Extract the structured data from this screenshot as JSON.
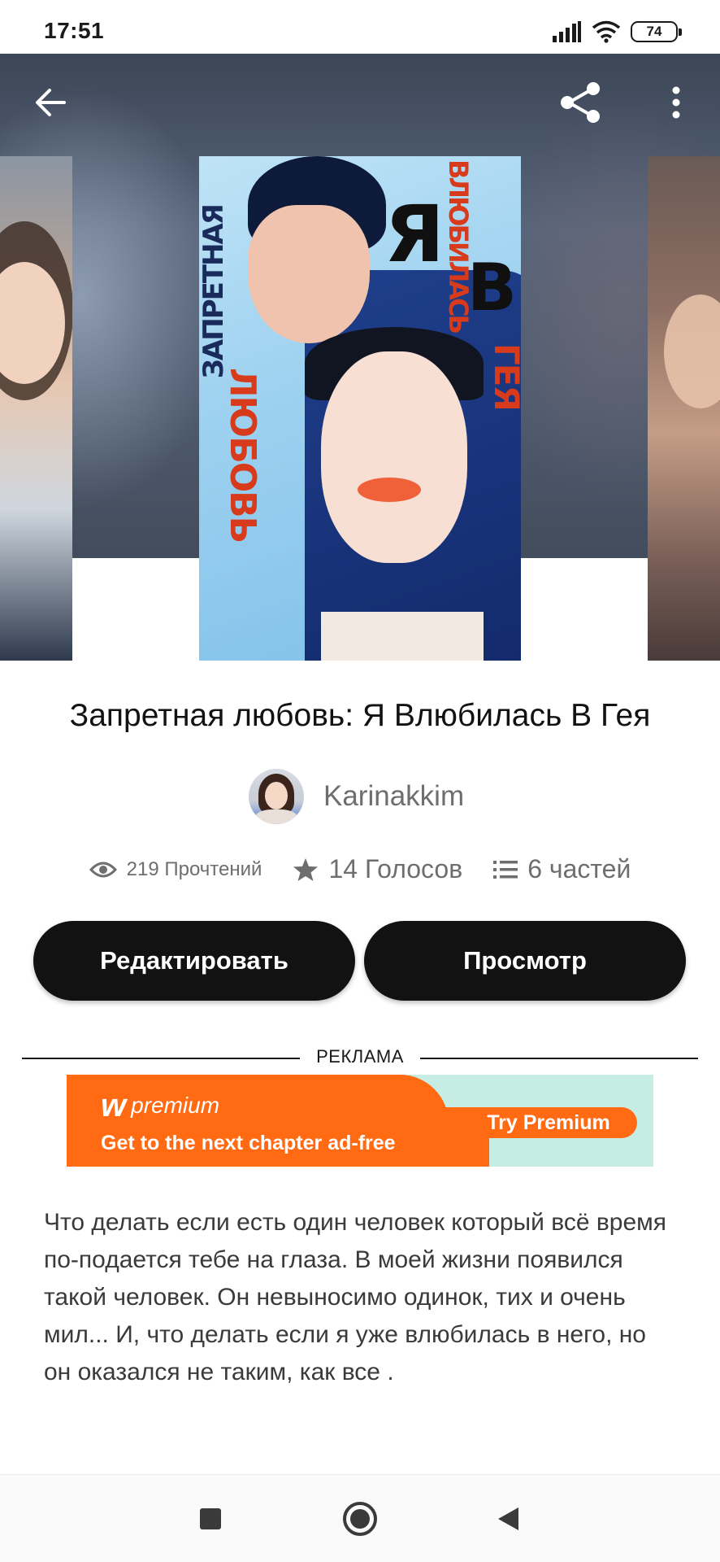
{
  "status_bar": {
    "time": "17:51",
    "battery": "74"
  },
  "cover_text": {
    "title_vertical_1": "ЗАПРЕТНАЯ",
    "title_vertical_2": "ЛЮБОВЬ",
    "letter_ya": "Я",
    "letter_v": "В",
    "word_vlyubilas": "ВЛЮБИЛАСЬ",
    "word_geya": "ГЕЯ"
  },
  "story": {
    "title": "Запретная любовь: Я Влюбилась В Гея",
    "author": "Karinakkim",
    "reads": "219 Прочтений",
    "votes": "14 Голосов",
    "parts": "6 частей",
    "description": "Что делать если есть один человек который всё время по-подается тебе на глаза. В моей жизни появился такой человек. Он невыносимо одинок, тих и очень мил... И, что делать если я уже влюбилась в него, но он оказался не таким, как все ."
  },
  "actions": {
    "edit_label": "Редактировать",
    "view_label": "Просмотр"
  },
  "ad": {
    "label": "РЕКЛАМА",
    "logo_letter": "w",
    "logo_text": "premium",
    "tagline": "Get to the next chapter ad-free",
    "cta": "Try Premium"
  },
  "icons": {
    "back": "back-arrow-icon",
    "share": "share-icon",
    "more": "more-vertical-icon",
    "reads": "eye-icon",
    "votes": "star-icon",
    "parts": "list-icon",
    "nav_recent": "square-icon",
    "nav_home": "circle-icon",
    "nav_back": "triangle-back-icon"
  },
  "colors": {
    "button_bg": "#121212",
    "ad_orange": "#ff6a13",
    "ad_mint": "#c6ede4",
    "secondary_text": "#6e6e6e"
  }
}
